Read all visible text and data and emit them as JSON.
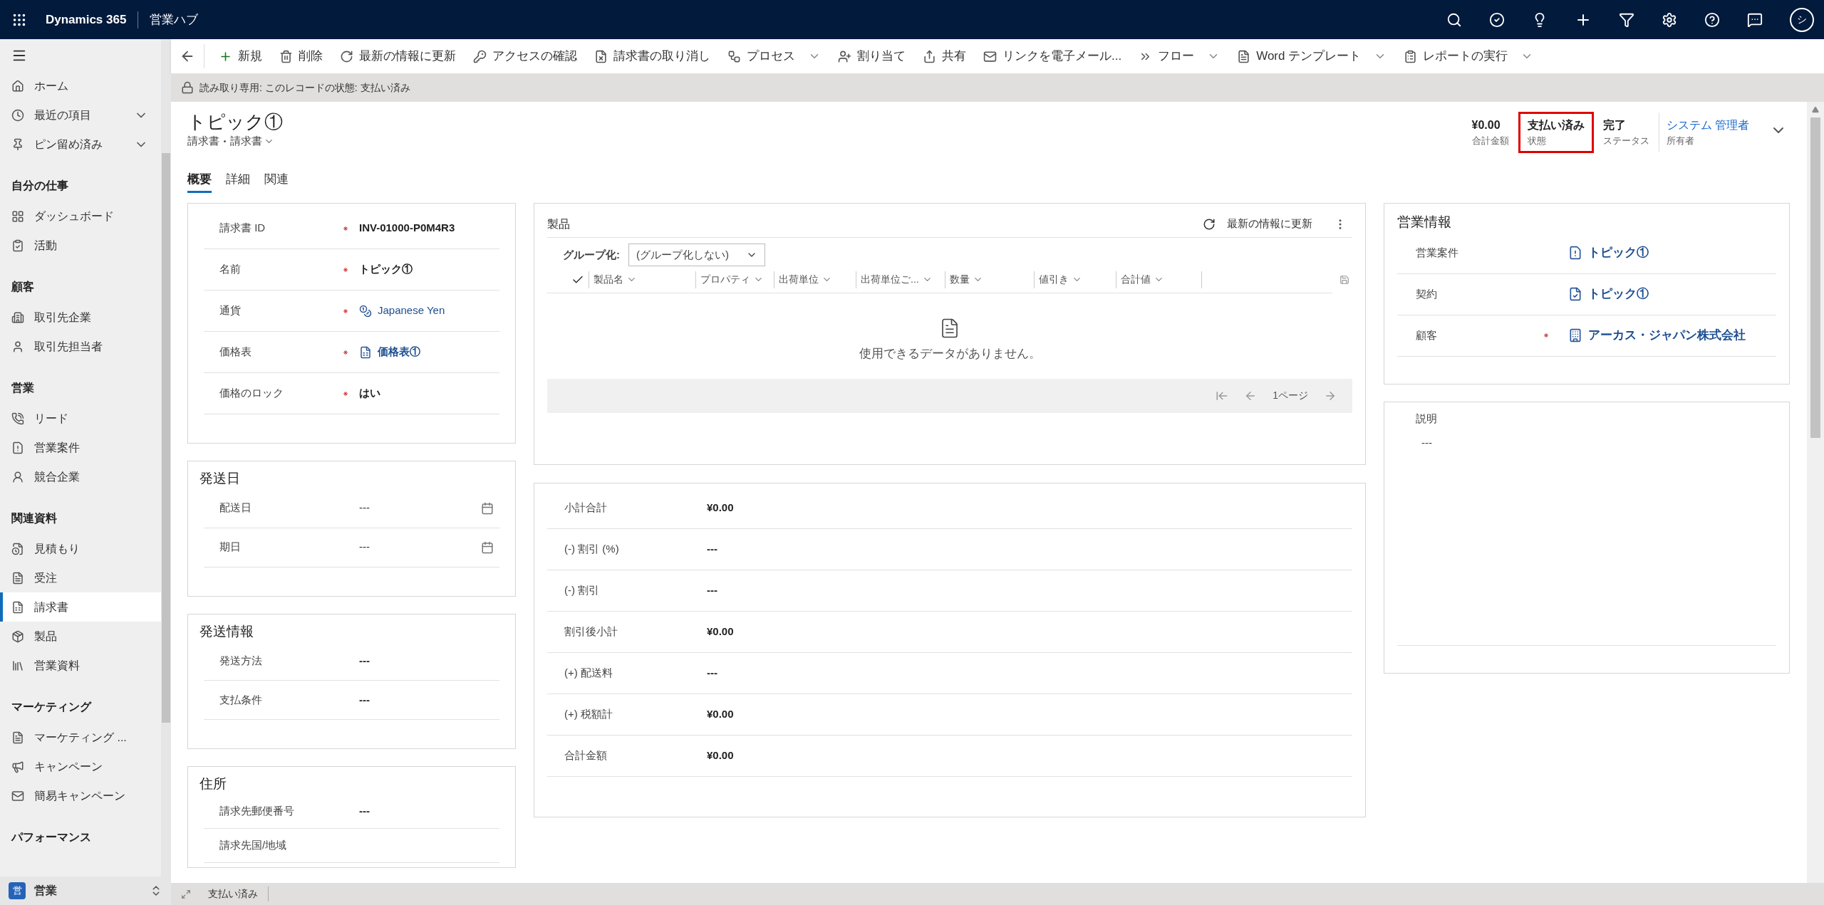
{
  "top_bar": {
    "app_name": "Dynamics 365",
    "area": "営業ハブ",
    "avatar": "シ"
  },
  "sidebar": {
    "items": [
      {
        "kind": "item",
        "label": "ホーム",
        "selected": false
      },
      {
        "kind": "expander",
        "label": "最近の項目",
        "selected": false
      },
      {
        "kind": "expander",
        "label": "ピン留め済み",
        "selected": false
      },
      {
        "kind": "heading",
        "label": "自分の仕事"
      },
      {
        "kind": "item",
        "label": "ダッシュボード",
        "selected": false
      },
      {
        "kind": "item",
        "label": "活動",
        "selected": false
      },
      {
        "kind": "heading",
        "label": "顧客"
      },
      {
        "kind": "item",
        "label": "取引先企業",
        "selected": false
      },
      {
        "kind": "item",
        "label": "取引先担当者",
        "selected": false
      },
      {
        "kind": "heading",
        "label": "営業"
      },
      {
        "kind": "item",
        "label": "リード",
        "selected": false
      },
      {
        "kind": "item",
        "label": "営業案件",
        "selected": false
      },
      {
        "kind": "item",
        "label": "競合企業",
        "selected": false
      },
      {
        "kind": "heading",
        "label": "関連資料"
      },
      {
        "kind": "item",
        "label": "見積もり",
        "selected": false
      },
      {
        "kind": "item",
        "label": "受注",
        "selected": false
      },
      {
        "kind": "item",
        "label": "請求書",
        "selected": true
      },
      {
        "kind": "item",
        "label": "製品",
        "selected": false
      },
      {
        "kind": "item",
        "label": "営業資料",
        "selected": false
      },
      {
        "kind": "heading",
        "label": "マーケティング"
      },
      {
        "kind": "item",
        "label": "マーケティング ...",
        "selected": false
      },
      {
        "kind": "item",
        "label": "キャンペーン",
        "selected": false
      },
      {
        "kind": "item",
        "label": "簡易キャンペーン",
        "selected": false
      },
      {
        "kind": "heading",
        "label": "パフォーマンス"
      }
    ],
    "area_switcher": {
      "badge": "営",
      "label": "営業"
    }
  },
  "command_bar": {
    "buttons": [
      {
        "label": "新規",
        "dropdown": false
      },
      {
        "label": "削除",
        "dropdown": false
      },
      {
        "label": "最新の情報に更新",
        "dropdown": false
      },
      {
        "label": "アクセスの確認",
        "dropdown": false
      },
      {
        "label": "請求書の取り消し",
        "dropdown": false
      },
      {
        "label": "プロセス",
        "dropdown": true
      },
      {
        "label": "割り当て",
        "dropdown": false
      },
      {
        "label": "共有",
        "dropdown": false
      },
      {
        "label": "リンクを電子メール...",
        "dropdown": false
      },
      {
        "label": "フロー",
        "dropdown": true
      },
      {
        "label": "Word テンプレート",
        "dropdown": true
      },
      {
        "label": "レポートの実行",
        "dropdown": true
      }
    ]
  },
  "readonly_notice": "読み取り専用: このレコードの状態: 支払い済み",
  "header": {
    "title": "トピック①",
    "entity": "請求書",
    "form": "請求書",
    "fields": [
      {
        "value": "¥0.00",
        "label": "合計金額",
        "highlighted": false,
        "link": false
      },
      {
        "value": "支払い済み",
        "label": "状態",
        "highlighted": true,
        "link": false
      },
      {
        "value": "完了",
        "label": "ステータス",
        "highlighted": false,
        "link": false
      },
      {
        "value": "システム 管理者",
        "label": "所有者",
        "highlighted": false,
        "link": true
      }
    ]
  },
  "tabs": [
    {
      "label": "概要",
      "selected": true
    },
    {
      "label": "詳細",
      "selected": false
    },
    {
      "label": "関連",
      "selected": false
    }
  ],
  "summary": {
    "fields": [
      {
        "label": "請求書 ID",
        "required": true,
        "value": "INV-01000-P0M4R3",
        "kind": "text"
      },
      {
        "label": "名前",
        "required": true,
        "value": "トピック①",
        "kind": "text"
      },
      {
        "label": "通貨",
        "required": true,
        "value": "Japanese Yen",
        "kind": "currency"
      },
      {
        "label": "価格表",
        "required": true,
        "value": "価格表①",
        "kind": "pricelist"
      },
      {
        "label": "価格のロック",
        "required": true,
        "value": "はい",
        "kind": "text"
      }
    ]
  },
  "ship_dates": {
    "title": "発送日",
    "fields": [
      {
        "label": "配送日",
        "value": "---",
        "kind": "date"
      },
      {
        "label": "期日",
        "value": "---",
        "kind": "date"
      }
    ]
  },
  "shipping_info": {
    "title": "発送情報",
    "fields": [
      {
        "label": "発送方法",
        "value": "---",
        "kind": "text"
      },
      {
        "label": "支払条件",
        "value": "---",
        "kind": "text"
      }
    ]
  },
  "address": {
    "title": "住所",
    "fields": [
      {
        "label": "請求先郵便番号",
        "value": "---",
        "kind": "text"
      },
      {
        "label": "請求先国/地域"
      }
    ]
  },
  "products": {
    "title": "製品",
    "refresh": "最新の情報に更新",
    "group_by_label": "グループ化:",
    "group_by_value": "(グループ化しない)",
    "columns": [
      "製品名",
      "プロパティ",
      "出荷単位",
      "出荷単位ご...",
      "数量",
      "値引き",
      "合計値"
    ],
    "empty_message": "使用できるデータがありません。",
    "page": "1ページ"
  },
  "totals": {
    "fields": [
      {
        "label": "小計合計",
        "value": "¥0.00"
      },
      {
        "label": "(-) 割引 (%)",
        "value": "---"
      },
      {
        "label": "(-) 割引",
        "value": "---"
      },
      {
        "label": "割引後小計",
        "value": "¥0.00"
      },
      {
        "label": "(+) 配送料",
        "value": "---"
      },
      {
        "label": "(+) 税額計",
        "value": "¥0.00"
      },
      {
        "label": "合計金額",
        "value": "¥0.00"
      }
    ]
  },
  "sales_info": {
    "title": "営業情報",
    "fields": [
      {
        "label": "営業案件",
        "required": false,
        "value": "トピック①",
        "kind": "opportunity"
      },
      {
        "label": "契約",
        "required": false,
        "value": "トピック①",
        "kind": "contract"
      },
      {
        "label": "顧客",
        "required": true,
        "value": "アーカス・ジャパン株式会社",
        "kind": "account"
      }
    ]
  },
  "description": {
    "label": "説明",
    "value": "---"
  },
  "status_bar": {
    "status": "支払い済み"
  }
}
